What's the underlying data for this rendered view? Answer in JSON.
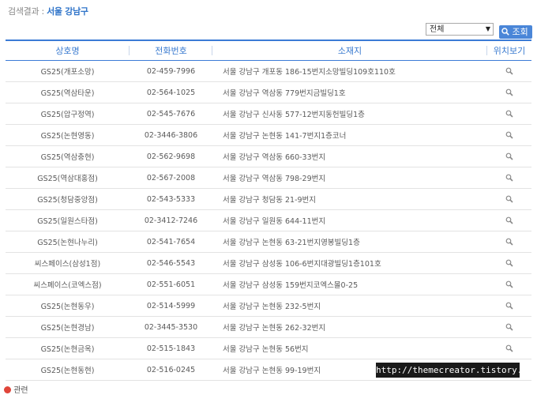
{
  "result": {
    "label": "검색결과 :",
    "region": "서울 강남구"
  },
  "filter": {
    "selected": "전체"
  },
  "search_button": {
    "label": "조회"
  },
  "table": {
    "headers": {
      "name": "상호명",
      "phone": "전화번호",
      "address": "소재지",
      "location": "위치보기"
    },
    "rows": [
      {
        "name": "GS25(개포소망)",
        "phone": "02-459-7996",
        "address": "서울 강남구 개포동 186-15번지소망빌딩109호110호"
      },
      {
        "name": "GS25(역삼타운)",
        "phone": "02-564-1025",
        "address": "서울 강남구 역삼동 779번지금빌딩1호"
      },
      {
        "name": "GS25(압구정역)",
        "phone": "02-545-7676",
        "address": "서울 강남구 신사동 577-12번지동헌빌딩1층"
      },
      {
        "name": "GS25(논현영동)",
        "phone": "02-3446-3806",
        "address": "서울 강남구 논현동 141-7번지1층코너"
      },
      {
        "name": "GS25(역삼충현)",
        "phone": "02-562-9698",
        "address": "서울 강남구 역삼동 660-33번지"
      },
      {
        "name": "GS25(역삼대홍점)",
        "phone": "02-567-2008",
        "address": "서울 강남구 역삼동 798-29번지"
      },
      {
        "name": "GS25(청담중앙점)",
        "phone": "02-543-5333",
        "address": "서울 강남구 청담동 21-9번지"
      },
      {
        "name": "GS25(일원스타점)",
        "phone": "02-3412-7246",
        "address": "서울 강남구 일원동 644-11번지"
      },
      {
        "name": "GS25(논현나누리)",
        "phone": "02-541-7654",
        "address": "서울 강남구 논현동 63-21번지영봉빌딩1층"
      },
      {
        "name": "씨스페이스(삼성1점)",
        "phone": "02-546-5543",
        "address": "서울 강남구 삼성동 106-6번지대광빌딩1층101호"
      },
      {
        "name": "씨스페이스(코엑스점)",
        "phone": "02-551-6051",
        "address": "서울 강남구 삼성동 159번지코엑스몰0-25"
      },
      {
        "name": "GS25(논현동우)",
        "phone": "02-514-5999",
        "address": "서울 강남구 논현동 232-5번지"
      },
      {
        "name": "GS25(논현경남)",
        "phone": "02-3445-3530",
        "address": "서울 강남구 논현동 262-32번지"
      },
      {
        "name": "GS25(논현금옥)",
        "phone": "02-515-1843",
        "address": "서울 강남구 논현동 56번지"
      },
      {
        "name": "GS25(논현동현)",
        "phone": "02-516-0245",
        "address": "서울 강남구 논현동 99-19번지"
      }
    ]
  },
  "watermark": "http://themecreator.tistory.com",
  "bottom_note": "관련",
  "colors": {
    "accent": "#3b7bd6",
    "button": "#4a86d8",
    "region": "#2f74c9"
  }
}
